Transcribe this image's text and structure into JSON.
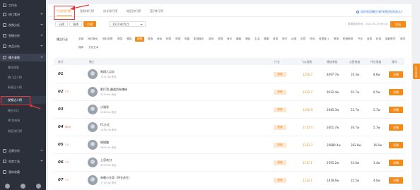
{
  "sidebar": {
    "items": [
      {
        "label": "工作台"
      },
      {
        "label": "热门素材"
      },
      {
        "label": "视频分析"
      },
      {
        "label": "直播分析"
      },
      {
        "label": "商品分析"
      },
      {
        "label": "播主查找"
      }
    ],
    "subitems": [
      {
        "label": "播主搜索"
      },
      {
        "label": "热门达人榜"
      },
      {
        "label": "新晋达人榜"
      },
      {
        "label": "视频达人榜"
      },
      {
        "label": "播主对比"
      },
      {
        "label": "MCN机构"
      },
      {
        "label": "地区排行榜"
      }
    ],
    "lower_items": [
      {
        "label": "品牌分析"
      },
      {
        "label": "电商工具"
      },
      {
        "label": "我的收藏"
      }
    ]
  },
  "top_tabs": [
    {
      "label": "行业排行榜"
    },
    {
      "label": "涨粉排行榜"
    },
    {
      "label": "成长排行榜"
    },
    {
      "label": "地区排行榜"
    },
    {
      "label": "蓝V排行榜"
    }
  ],
  "help_link": "如何利用播主排行榜找到优质达人",
  "filters": {
    "period_buttons": [
      {
        "label": "日榜"
      },
      {
        "label": "周榜"
      },
      {
        "label": "月榜"
      }
    ],
    "date_value": "2021年05月",
    "update_time": "数据更新时间：2021-05-29 06:00",
    "export_label": "导出"
  },
  "categories": {
    "label": "播主行业",
    "row1": [
      "全部",
      "网红美女",
      "网红帅哥",
      "搞笑",
      "情感",
      "剧情",
      "美食",
      "美妆",
      "种草",
      "穿搭",
      "明星",
      "影视娱乐",
      "游戏",
      "宠物",
      "音乐",
      "舞蹈",
      "萌娃",
      "生活",
      "健康",
      "体育",
      "旅行",
      "动漫",
      "创意",
      "时尚",
      "母婴育儿",
      "教育",
      "职场教育",
      "汽车",
      "家居",
      "科技",
      "摄影教学",
      "政务"
    ],
    "row2": [
      "媒体",
      "文化艺术"
    ],
    "active": "剧情"
  },
  "table": {
    "headers": [
      "排行",
      "播主",
      "行业",
      "飞瓜指数",
      "播放增量",
      "点赞增量",
      "评论增量",
      "操作"
    ],
    "rows": [
      {
        "rank": "01",
        "change": "",
        "name": "陈翔六点半",
        "fans": "7471.3w 粉丝",
        "industry": "剧情",
        "index": "1256.7",
        "plays": "8497.7w",
        "likes": "10.3w",
        "comments": "8.6w",
        "action": "详情"
      },
      {
        "rank": "02",
        "change": "↑3",
        "name": "影打哥_霸道尚有辣妹",
        "fans": "2424.6w 粉丝",
        "industry": "剧情",
        "index": "1222.7",
        "plays": "9032.4w",
        "likes": "65.7w",
        "comments": "6.5w",
        "action": "详情"
      },
      {
        "rank": "03",
        "change": "",
        "name": "沙驰导",
        "fans": "2046.0w 粉丝",
        "industry": "剧情",
        "index": "1192.9",
        "plays": "2845.3w",
        "likes": "52.7w",
        "comments": "5.7w",
        "action": "详情"
      },
      {
        "rank": "04",
        "change": "NEW",
        "name": "F1方式",
        "fans": "1038.7w 粉丝",
        "industry": "剧情",
        "index": "1172.5",
        "plays": "2601.7w",
        "likes": "36.7w",
        "comments": "5.7w",
        "action": "详情"
      },
      {
        "rank": "05",
        "change": "↑4",
        "name": "锅锅趣",
        "fans": "2604.4w 粉丝",
        "industry": "剧情",
        "index": "1142.7",
        "plays": "20889.4w",
        "likes": "382.8w",
        "comments": "16.6w",
        "action": "详情"
      },
      {
        "rank": "06",
        "change": "↑3",
        "name": "上官帝刀",
        "fans": "3029.9w 粉丝",
        "industry": "剧情",
        "index": "1137.1",
        "plays": "2595.2w",
        "likes": "33.6w",
        "comments": "3.4w",
        "action": "详情"
      },
      {
        "rank": "07",
        "change": "↑3",
        "name": "朱朝小天奇（特仑苏生）",
        "fans": "1719.3w 粉丝",
        "industry": "剧情",
        "index": "1132.1",
        "plays": "1878.6w",
        "likes": "35.5w",
        "comments": "4.0w",
        "action": "详情"
      }
    ]
  },
  "right_float": "联系客服",
  "colors": {
    "accent": "#f28b1a",
    "sidebar": "#2b303b",
    "annotation": "#e23b3b"
  }
}
